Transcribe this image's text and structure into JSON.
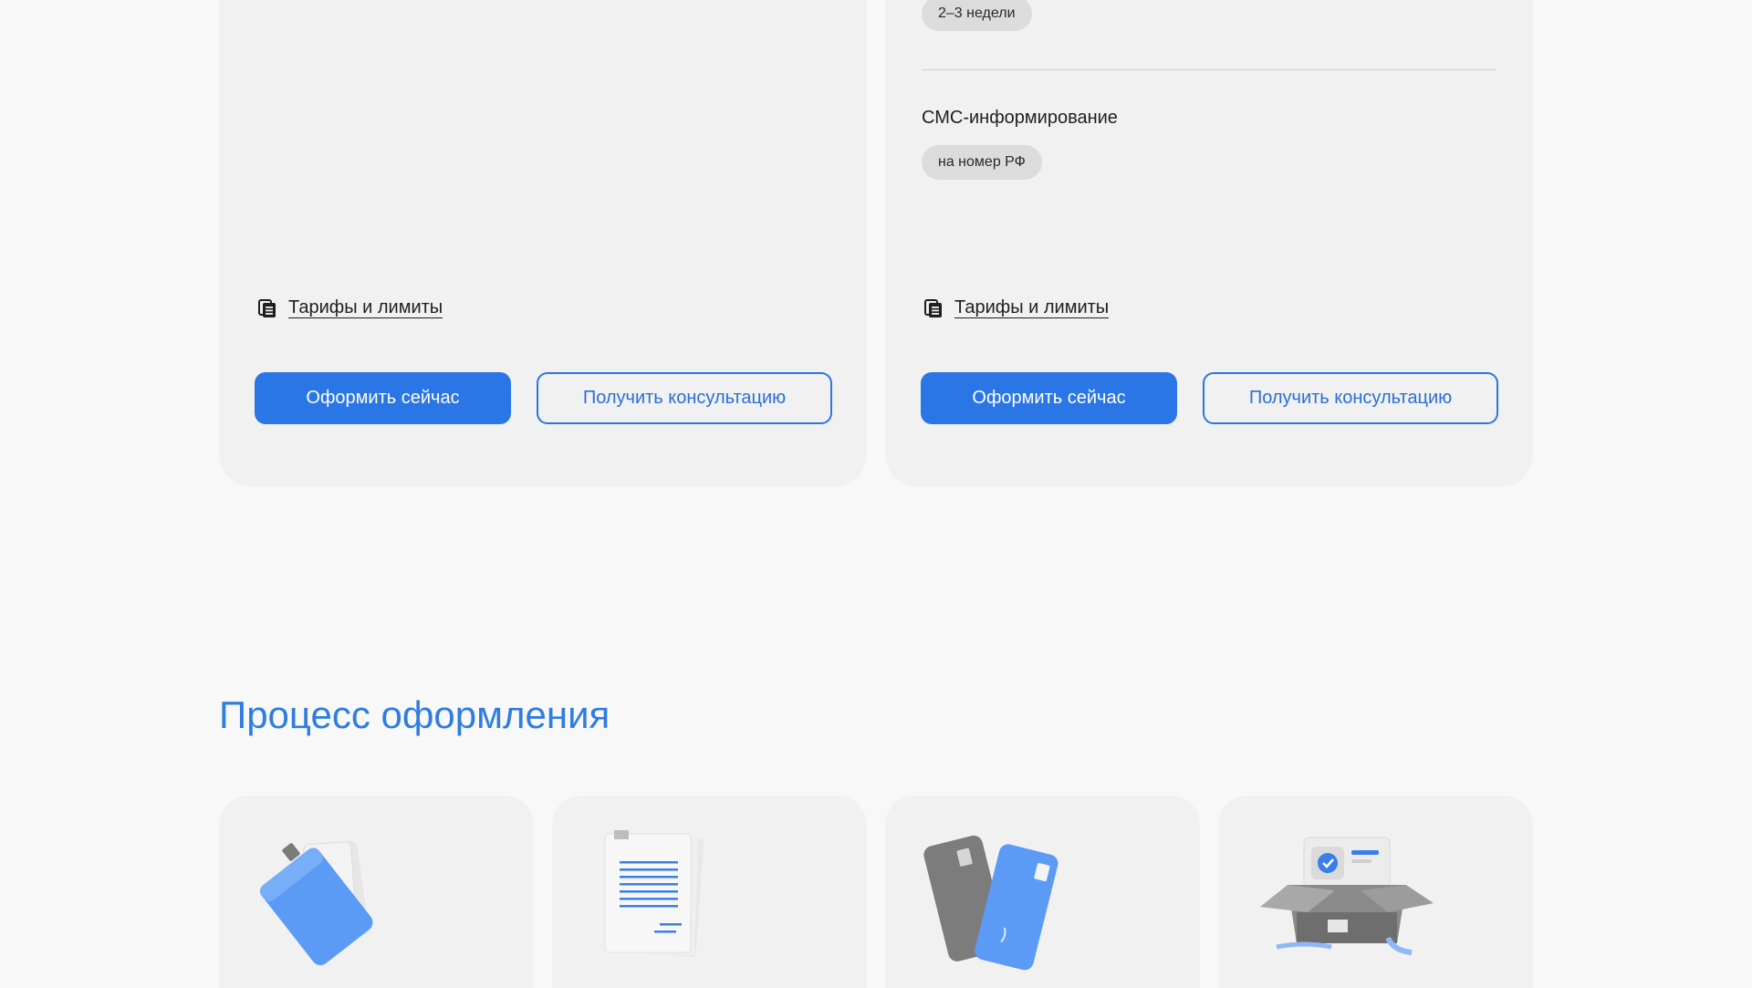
{
  "left_card": {
    "tariff_link": "Тарифы и лимиты",
    "primary_button": "Оформить сейчас",
    "secondary_button": "Получить консультацию"
  },
  "right_card": {
    "duration_pill": "2–3 недели",
    "sms_title": "СМС-информирование",
    "sms_pill": "на номер РФ",
    "tariff_link": "Тарифы и лимиты",
    "primary_button": "Оформить сейчас",
    "secondary_button": "Получить консультацию"
  },
  "process": {
    "title": "Процесс оформления",
    "steps": [
      {
        "icon": "documents-folder-icon"
      },
      {
        "icon": "document-sheet-icon"
      },
      {
        "icon": "bank-cards-icon"
      },
      {
        "icon": "delivery-box-icon"
      }
    ]
  },
  "colors": {
    "accent": "#2a76e6",
    "title": "#2f7de1",
    "card_bg": "#f1f1f1",
    "page_bg": "#f8f8f8"
  }
}
